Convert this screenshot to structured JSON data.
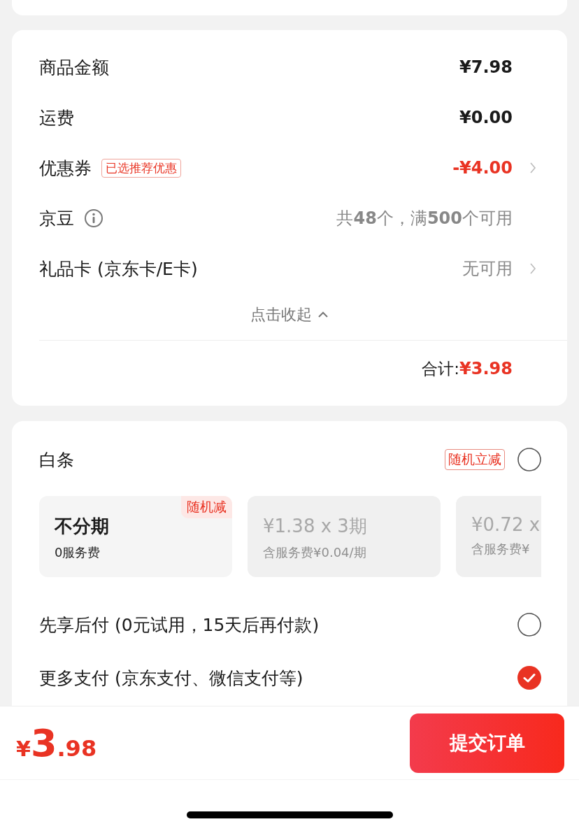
{
  "summary": {
    "rows": [
      {
        "kind": "amount",
        "label": "商品金额",
        "value": "¥7.98"
      },
      {
        "kind": "amount",
        "label": "运费",
        "value": "¥0.00"
      },
      {
        "kind": "coupon",
        "label": "优惠券",
        "tag": "已选推荐优惠",
        "value": "-¥4.00"
      },
      {
        "kind": "beans",
        "label": "京豆",
        "value": "共**48**个，满**500**个可用"
      },
      {
        "kind": "gift",
        "label": "礼品卡 (京东卡/E卡)",
        "value": "无可用"
      }
    ],
    "collapse": "点击收起",
    "total_label": "合计:",
    "total_value": "¥3.98"
  },
  "payment": {
    "baitiao": {
      "label": "白条",
      "tag": "随机立减",
      "selected": false
    },
    "plans": [
      {
        "title": "不分期",
        "subtitle": "0服务费",
        "badge": "随机减",
        "disabled": false
      },
      {
        "title": "¥1.38 x 3期",
        "subtitle": "含服务费¥0.04/期",
        "disabled": true
      },
      {
        "title": "¥0.72 x",
        "subtitle": "含服务费¥",
        "disabled": true
      }
    ],
    "options": [
      {
        "label": "先享后付 (0元试用，15天后再付款)",
        "selected": false
      },
      {
        "label": "更多支付 (京东支付、微信支付等)",
        "selected": true
      }
    ]
  },
  "bottom_bar": {
    "currency": "¥",
    "integer": "3",
    "decimal": ".98",
    "submit": "提交订单"
  }
}
